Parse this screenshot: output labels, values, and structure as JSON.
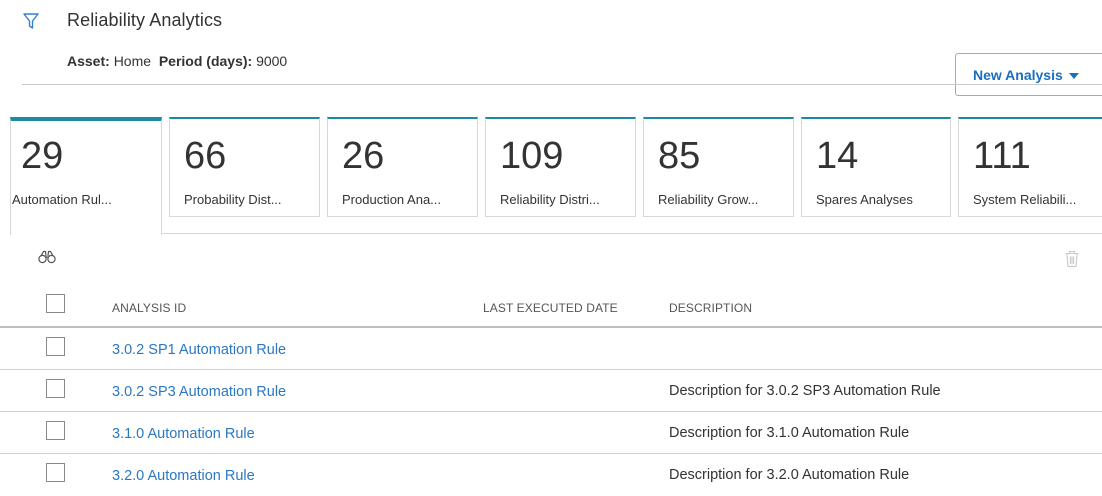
{
  "header": {
    "title": "Reliability Analytics",
    "asset_label": "Asset:",
    "asset_value": "Home",
    "period_label": "Period (days):",
    "period_value": "9000",
    "new_analysis_label": "New Analysis"
  },
  "tiles": [
    {
      "count": "29",
      "label": "Automation Rul...",
      "active": true
    },
    {
      "count": "66",
      "label": "Probability Dist...",
      "active": false
    },
    {
      "count": "26",
      "label": "Production Ana...",
      "active": false
    },
    {
      "count": "109",
      "label": "Reliability Distri...",
      "active": false
    },
    {
      "count": "85",
      "label": "Reliability Grow...",
      "active": false
    },
    {
      "count": "14",
      "label": "Spares Analyses",
      "active": false
    },
    {
      "count": "111",
      "label": "System Reliabili...",
      "active": false
    }
  ],
  "table": {
    "columns": {
      "analysis_id": "ANALYSIS ID",
      "last_executed_date": "LAST EXECUTED DATE",
      "description": "DESCRIPTION"
    },
    "rows": [
      {
        "analysis_id": "3.0.2 SP1 Automation Rule",
        "last_executed_date": "",
        "description": ""
      },
      {
        "analysis_id": "3.0.2 SP3 Automation Rule",
        "last_executed_date": "",
        "description": "Description for 3.0.2 SP3 Automation Rule"
      },
      {
        "analysis_id": "3.1.0 Automation Rule",
        "last_executed_date": "",
        "description": "Description for 3.1.0 Automation Rule"
      },
      {
        "analysis_id": "3.2.0 Automation Rule",
        "last_executed_date": "",
        "description": "Description for 3.2.0 Automation Rule"
      }
    ]
  },
  "icons": {
    "filter": "filter-icon",
    "search": "binoculars-icon",
    "delete": "trash-icon",
    "dropdown": "caret-down-icon"
  },
  "colors": {
    "accent": "#1c8aa0",
    "link": "#2a78c4",
    "button_text": "#1a6fbf"
  }
}
